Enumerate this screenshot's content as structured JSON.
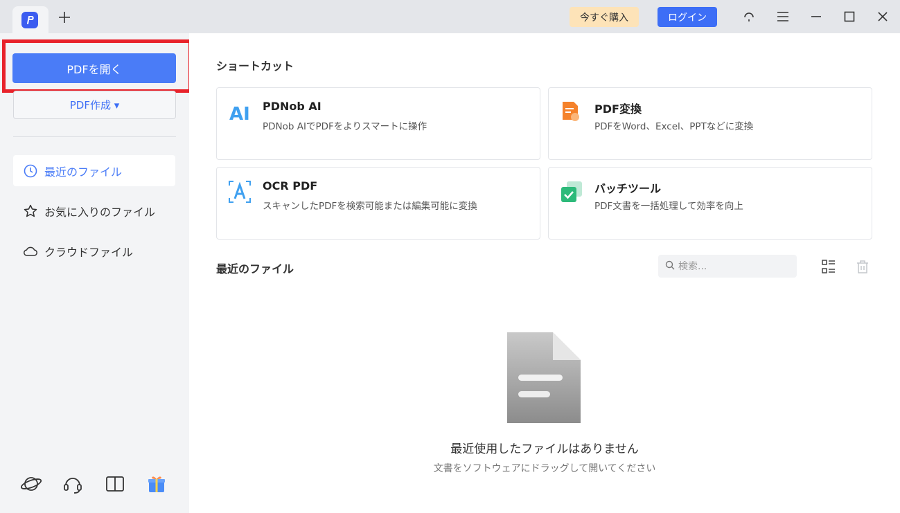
{
  "titlebar": {
    "new_tab": "+",
    "buy_label": "今すぐ購入",
    "login_label": "ログイン"
  },
  "sidebar": {
    "open_label": "PDFを開く",
    "create_label": "PDF作成 ▾",
    "nav": [
      {
        "label": "最近のファイル",
        "icon": "clock-icon"
      },
      {
        "label": "お気に入りのファイル",
        "icon": "star-icon"
      },
      {
        "label": "クラウドファイル",
        "icon": "cloud-icon"
      }
    ]
  },
  "main": {
    "shortcuts_title": "ショートカット",
    "cards": [
      {
        "title": "PDNob AI",
        "desc": "PDNob AIでPDFをよりスマートに操作"
      },
      {
        "title": "PDF変換",
        "desc": "PDFをWord、Excel、PPTなどに変換"
      },
      {
        "title": "OCR PDF",
        "desc": "スキャンしたPDFを検索可能または編集可能に変換"
      },
      {
        "title": "バッチツール",
        "desc": "PDF文書を一括処理して効率を向上"
      }
    ],
    "recent_title": "最近のファイル",
    "search_placeholder": "検索...",
    "empty_title": "最近使用したファイルはありません",
    "empty_sub": "文書をソフトウェアにドラッグして開いてください"
  },
  "colors": {
    "accent": "#4a7cf7",
    "highlight": "#e8222a",
    "buy_bg": "#fde3b8"
  }
}
